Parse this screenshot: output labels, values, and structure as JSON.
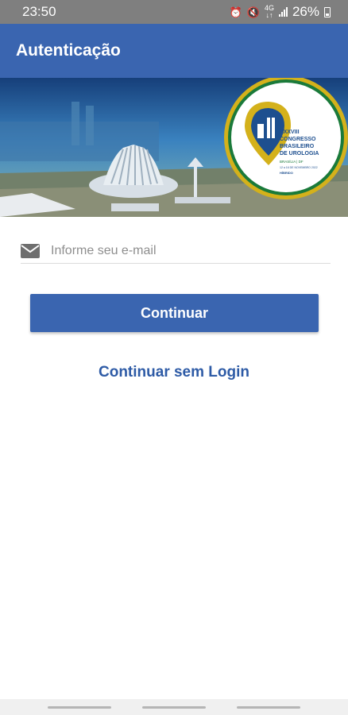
{
  "status_bar": {
    "time": "23:50",
    "icons": [
      "alarm-icon",
      "mute-icon",
      "4g-icon",
      "signal-icon"
    ],
    "battery": "26%"
  },
  "app_bar": {
    "title": "Autenticação",
    "color": "#3a65b0"
  },
  "banner": {
    "logo": {
      "lines": [
        "XXXVIII",
        "CONGRESSO",
        "BRASILEIRO",
        "DE UROLOGIA"
      ],
      "location": "BRASÍLIA | DF",
      "dates": "12 a 16 DE NOVEMBRO 2022",
      "format": "HÍBRIDO",
      "colors": {
        "gold": "#d4b11b",
        "green": "#1a7a3a",
        "blue": "#1d4f8f"
      }
    }
  },
  "form": {
    "email_placeholder": "Informe seu e-mail",
    "email_value": "",
    "continue_label": "Continuar",
    "no_login_label": "Continuar sem Login"
  },
  "colors": {
    "primary": "#3a65b0",
    "link": "#2e5ba6",
    "status_bar": "#7f7f7f"
  }
}
